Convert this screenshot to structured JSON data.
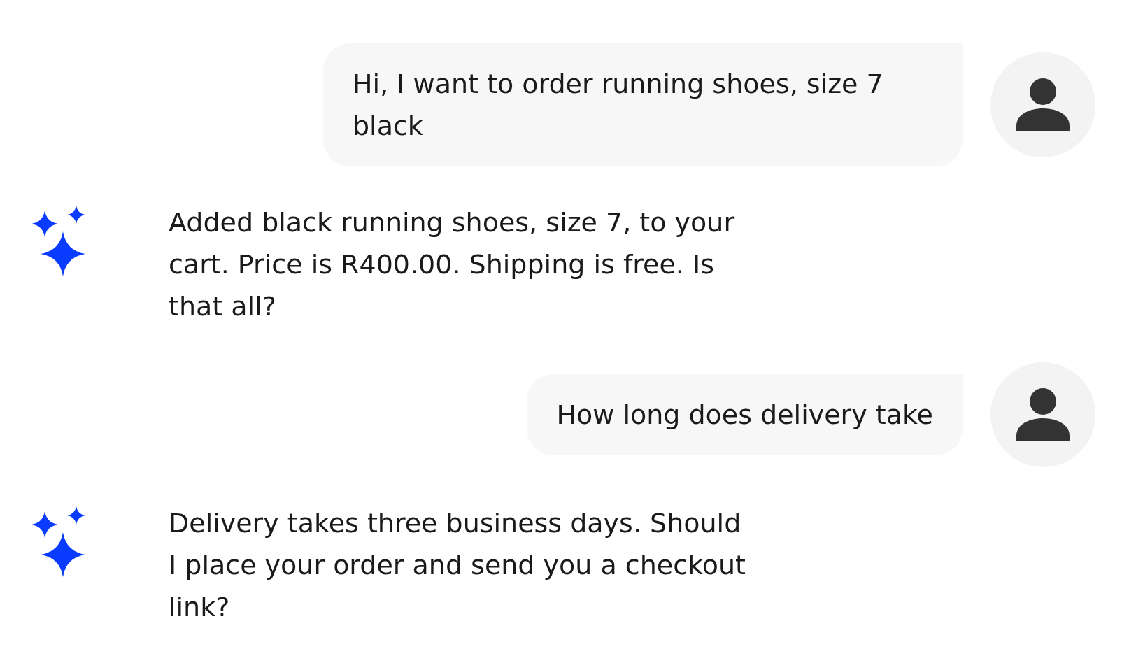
{
  "messages": [
    {
      "kind": "user",
      "text": "Hi, I want to order running shoes, size 7 black"
    },
    {
      "kind": "bot",
      "text": "Added black running shoes, size 7, to your cart. Price is R400.00. Shipping is free. Is that all?"
    },
    {
      "kind": "user",
      "text": "How long does delivery take"
    },
    {
      "kind": "bot",
      "text": "Delivery takes three business days. Should I place your order and send you a checkout link?"
    }
  ]
}
